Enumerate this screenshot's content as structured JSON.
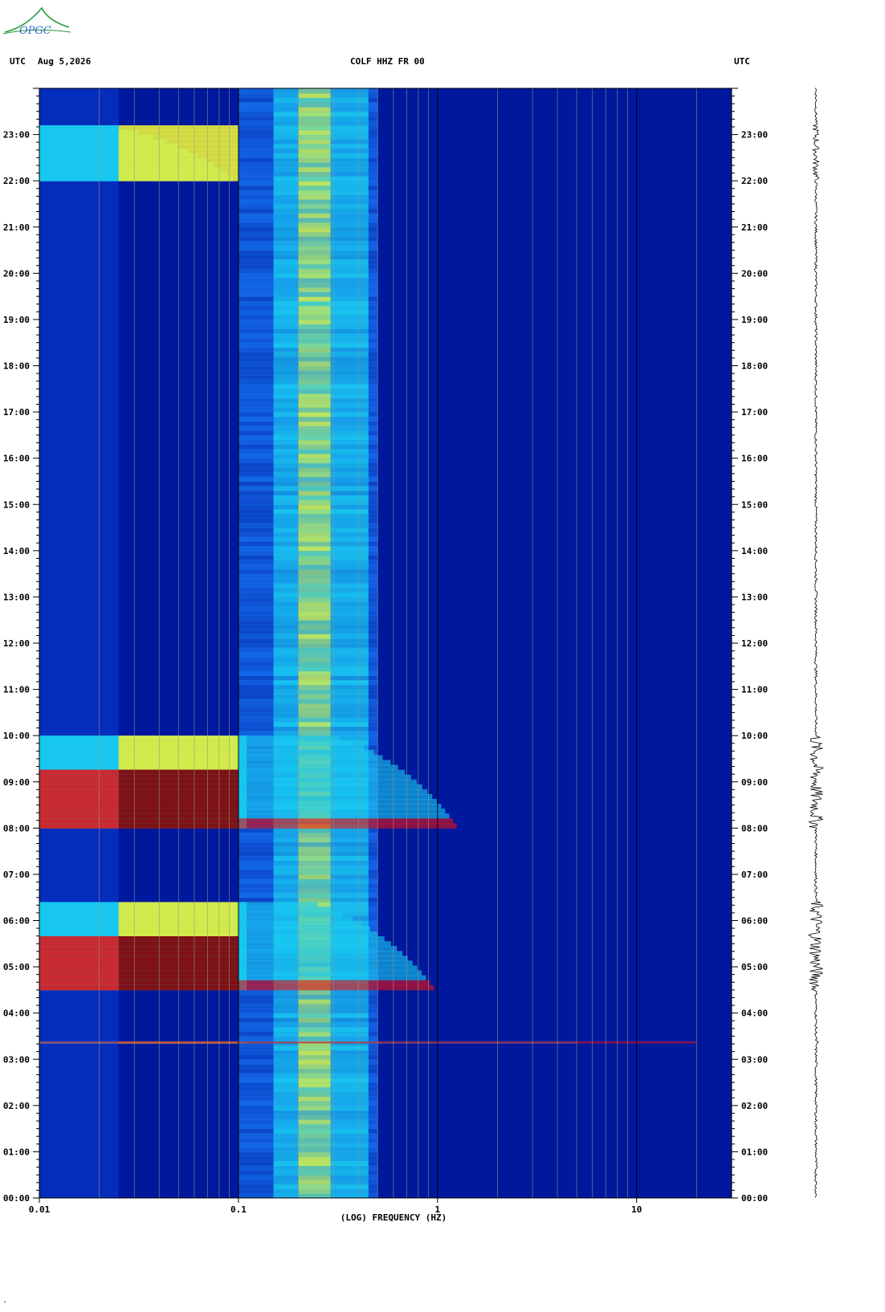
{
  "logo_text": "OPGC",
  "header": {
    "left_tz": "UTC",
    "date": "Aug 5,2026",
    "station": "COLF HHZ FR 00",
    "right_tz": "UTC"
  },
  "footnote": "\"",
  "colors": {
    "background": "#00189e",
    "cold": "#0a3fd6",
    "cyan": "#19c9f0",
    "yellow": "#e8f03a",
    "red": "#e81010",
    "darkred": "#8a0000",
    "grid": "#9a9a7a"
  },
  "chart_data": {
    "type": "heatmap",
    "title": "COLF HHZ FR 00",
    "xlabel": "(LOG) FREQUENCY (HZ)",
    "ylabel": "UTC",
    "x_scale": "log",
    "xlim": [
      0.01,
      30
    ],
    "ylim": [
      "00:00",
      "24:00"
    ],
    "x_ticks": [
      {
        "value": 0.01,
        "label": "0.01"
      },
      {
        "value": 0.1,
        "label": "0.1"
      },
      {
        "value": 1,
        "label": "1"
      },
      {
        "value": 10,
        "label": "10"
      }
    ],
    "y_ticks": [
      "00:00",
      "01:00",
      "02:00",
      "03:00",
      "04:00",
      "05:00",
      "06:00",
      "07:00",
      "08:00",
      "09:00",
      "10:00",
      "11:00",
      "12:00",
      "13:00",
      "14:00",
      "15:00",
      "16:00",
      "17:00",
      "18:00",
      "19:00",
      "20:00",
      "21:00",
      "22:00",
      "23:00"
    ],
    "grid": true,
    "microseism_band_hz": [
      0.15,
      0.45
    ],
    "events": [
      {
        "start_hour": 3.35,
        "end_hour": 3.38,
        "fmax_hz": 20,
        "peak": "red"
      },
      {
        "start_hour": 4.5,
        "end_hour": 6.4,
        "fmax_hz": 1.0,
        "peak": "darkred"
      },
      {
        "start_hour": 8.0,
        "end_hour": 10.0,
        "fmax_hz": 1.3,
        "peak": "darkred"
      },
      {
        "start_hour": 22.0,
        "end_hour": 23.2,
        "fmax_hz": 0.1,
        "peak": "yellow"
      }
    ]
  }
}
